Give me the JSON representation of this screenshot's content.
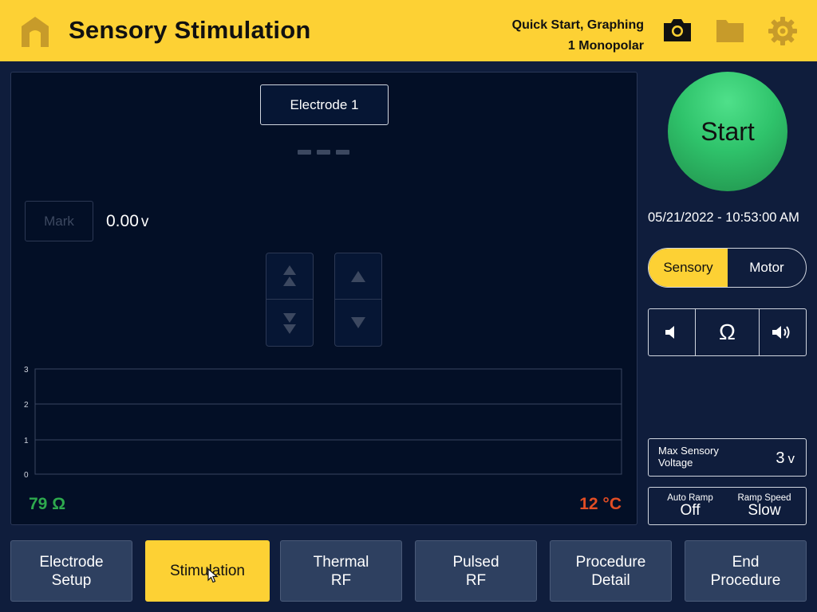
{
  "header": {
    "title": "Sensory Stimulation",
    "info_line1": "Quick Start, Graphing",
    "info_line2": "1 Monopolar",
    "icons": [
      "home-icon",
      "camera-icon",
      "folder-icon",
      "gear-icon"
    ]
  },
  "panel": {
    "electrode_label": "Electrode 1",
    "mark_label": "Mark",
    "voltage_value": "0.00",
    "voltage_unit": "v",
    "impedance": "79 Ω",
    "temperature": "12 °C",
    "chart": {
      "y_ticks": [
        "3",
        "2",
        "1",
        "0"
      ]
    }
  },
  "chart_data": {
    "type": "line",
    "ylim": [
      0,
      3
    ],
    "yticks": [
      0,
      1,
      2,
      3
    ],
    "series": [],
    "grid": true
  },
  "right": {
    "start_label": "Start",
    "datetime": "05/21/2022 - 10:53:00 AM",
    "mode_sensory": "Sensory",
    "mode_motor": "Motor",
    "omega": "Ω",
    "max_label": "Max Sensory Voltage",
    "max_value": "3",
    "max_unit": "v",
    "auto_ramp_label": "Auto Ramp",
    "auto_ramp_value": "Off",
    "ramp_speed_label": "Ramp Speed",
    "ramp_speed_value": "Slow"
  },
  "nav": [
    {
      "line1": "Electrode",
      "line2": "Setup"
    },
    {
      "line1": "Stimulation",
      "line2": ""
    },
    {
      "line1": "Thermal",
      "line2": "RF"
    },
    {
      "line1": "Pulsed",
      "line2": "RF"
    },
    {
      "line1": "Procedure",
      "line2": "Detail"
    },
    {
      "line1": "End",
      "line2": "Procedure"
    }
  ],
  "colors": {
    "accent": "#fdd134",
    "background": "#0f1d3c",
    "panel": "#030f26",
    "nav_button": "#2e4060",
    "start": "#2fc36b",
    "impedance": "#2eaa4e",
    "temperature": "#e24d24"
  }
}
